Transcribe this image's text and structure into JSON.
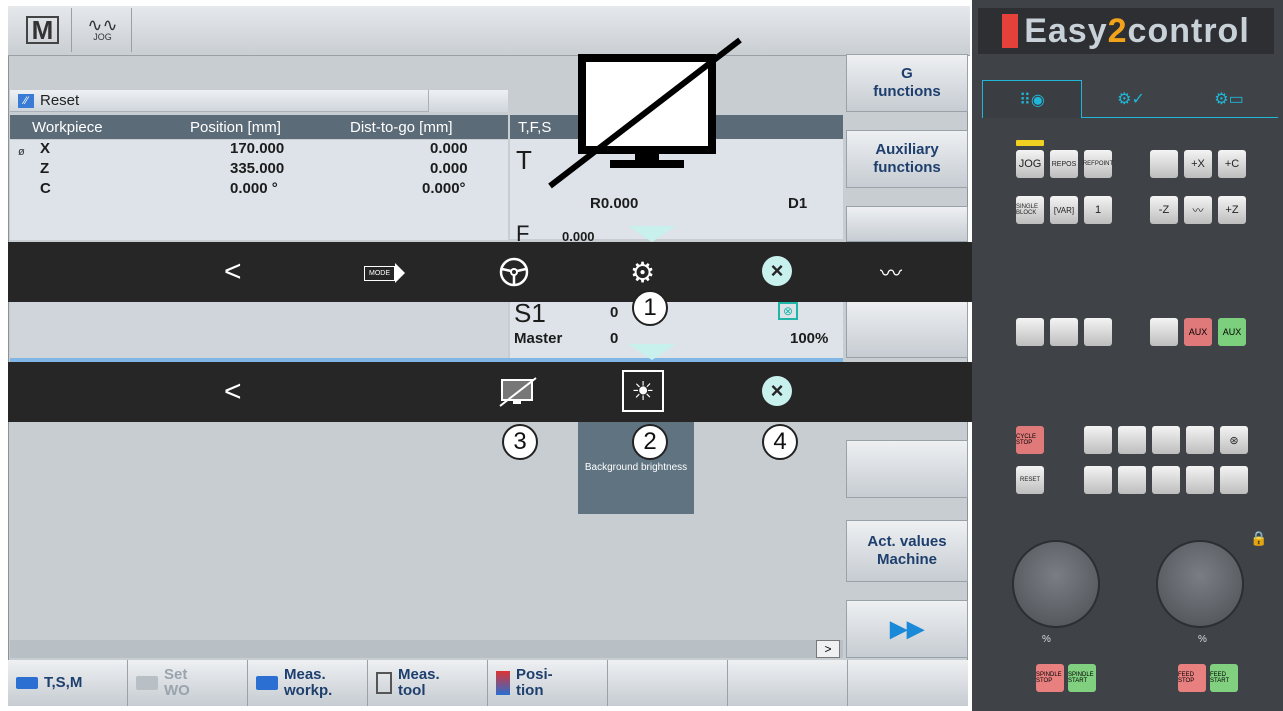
{
  "top": {
    "mode_jog": "JOG"
  },
  "status": {
    "reset": "Reset"
  },
  "table": {
    "headers": [
      "Workpiece",
      "Position [mm]",
      "Dist-to-go [mm]"
    ],
    "rows": [
      {
        "axis": "X",
        "position": "170.000",
        "dist": "0.000"
      },
      {
        "axis": "Z",
        "position": "335.000",
        "dist": "0.000"
      },
      {
        "axis": "C",
        "position": "0.000 °",
        "dist": "0.000°"
      }
    ]
  },
  "tfs": {
    "header": "T,F,S",
    "t_label": "T",
    "r_value": "R0.000",
    "d_value": "D1",
    "f_label": "F",
    "f_value": "0.000",
    "s_label": "S1",
    "s_value": "0",
    "master_label": "Master",
    "master_value": "0",
    "percent": "100%"
  },
  "softkeys": {
    "g_functions": [
      "G",
      "functions"
    ],
    "aux_functions": [
      "Auxiliary",
      "functions"
    ],
    "act_values": [
      "Act. values",
      "Machine"
    ]
  },
  "more_label": ">",
  "bottom": {
    "tsm": "T,S,M",
    "set_wo": [
      "Set",
      "WO"
    ],
    "meas_workp": [
      "Meas.",
      "workp."
    ],
    "meas_tool": [
      "Meas.",
      "tool"
    ],
    "position": [
      "Posi-",
      "tion"
    ]
  },
  "overlay": {
    "mode_label": "MODE",
    "brightness_tile": "Background brightness",
    "callouts": [
      "1",
      "2",
      "3",
      "4"
    ]
  },
  "panel": {
    "logo_a": "Easy",
    "logo_b": "2",
    "logo_c": "control",
    "keys": {
      "jog": "JOG",
      "repos": "REPOS",
      "refpoint": "REFPOINT",
      "single_block": "SINGLE BLOCK",
      "var": "[VAR]",
      "one": "1",
      "plus_x": "+X",
      "plus_c": "+C",
      "minus_z": "-Z",
      "plus_z": "+Z",
      "aux_a": "AUX",
      "aux_b": "AUX",
      "cycle_stop": "CYCLE STOP",
      "reset": "RESET",
      "spindle_stop": "SPINDLE STOP",
      "spindle_start": "SPINDLE START",
      "feed_stop": "FEED STOP",
      "feed_start": "FEED START"
    },
    "knob_left_label": "%",
    "knob_right_label": "%"
  },
  "colors": {
    "accent": "#1fb6d8",
    "overlay_bar": "#262626",
    "header_bg": "#5c6b78",
    "softkey_text": "#1e3f6e"
  }
}
